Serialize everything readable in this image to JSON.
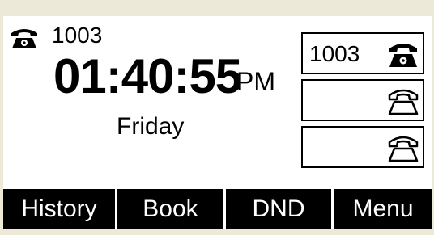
{
  "account": {
    "icon": "phone-handset-icon",
    "number": "1003"
  },
  "clock": {
    "time": "01:40:55",
    "ampm": "PM",
    "day": "Friday"
  },
  "line_keys": [
    {
      "label": "1003",
      "icon": "phone-handset-filled-icon"
    },
    {
      "label": "",
      "icon": "phone-handset-outline-icon"
    },
    {
      "label": "",
      "icon": "phone-handset-outline-icon"
    }
  ],
  "softkeys": [
    {
      "label": "History"
    },
    {
      "label": "Book"
    },
    {
      "label": "DND"
    },
    {
      "label": "Menu"
    }
  ]
}
